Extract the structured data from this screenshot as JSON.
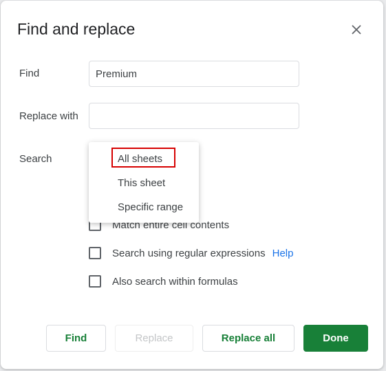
{
  "dialog": {
    "title": "Find and replace",
    "close_icon": "close-icon"
  },
  "find": {
    "label": "Find",
    "value": "Premium"
  },
  "replace": {
    "label": "Replace with",
    "value": ""
  },
  "search": {
    "label": "Search",
    "options": [
      "All sheets",
      "This sheet",
      "Specific range"
    ],
    "highlighted_option": "All sheets",
    "highlight_color": "#d60000"
  },
  "options": {
    "match_case_partial": "Match entire cell contents",
    "regex": "Search using regular expressions",
    "help": "Help",
    "formulas": "Also search within formulas"
  },
  "buttons": {
    "find": "Find",
    "replace": "Replace",
    "replace_all": "Replace all",
    "done": "Done"
  },
  "colors": {
    "accent": "#188038",
    "link": "#1a73e8"
  }
}
